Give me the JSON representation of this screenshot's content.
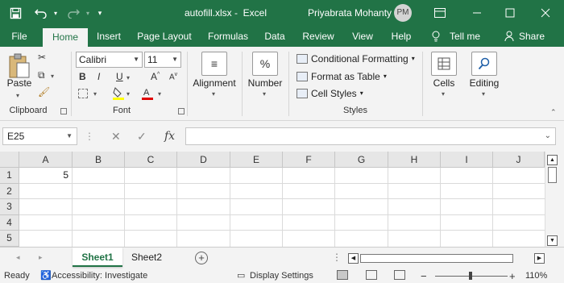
{
  "titlebar": {
    "filename": "autofill.xlsx",
    "app_name": "Excel",
    "title_sep": " -  ",
    "user_name": "Priyabrata Mohanty",
    "user_initials": "PM",
    "accent_color": "#217346",
    "icons": {
      "save": "save-icon",
      "undo": "undo-icon",
      "redo": "redo-icon",
      "customize": "customize-qat-icon",
      "ribbon_display": "ribbon-display-icon",
      "minimize": "minimize-icon",
      "maximize": "maximize-icon",
      "close": "close-icon"
    }
  },
  "tabs": [
    {
      "label": "File"
    },
    {
      "label": "Home",
      "active": true
    },
    {
      "label": "Insert"
    },
    {
      "label": "Page Layout"
    },
    {
      "label": "Formulas"
    },
    {
      "label": "Data"
    },
    {
      "label": "Review"
    },
    {
      "label": "View"
    },
    {
      "label": "Help"
    },
    {
      "label": "Tell me"
    },
    {
      "label": "Share"
    }
  ],
  "ribbon": {
    "clipboard": {
      "label": "Clipboard",
      "paste": "Paste"
    },
    "font": {
      "label": "Font",
      "name": "Calibri",
      "size": "11",
      "bold": "B",
      "italic": "I",
      "underline": "U",
      "grow": "A",
      "shrink": "A"
    },
    "alignment": {
      "label": "Alignment",
      "icon_glyph": "≡"
    },
    "number": {
      "label": "Number",
      "icon_glyph": "%"
    },
    "styles": {
      "label": "Styles",
      "conditional": "Conditional Formatting",
      "format_table": "Format as Table",
      "cell_styles": "Cell Styles"
    },
    "cells": {
      "label": "Cells"
    },
    "editing": {
      "label": "Editing"
    }
  },
  "formula_bar": {
    "name_box": "E25",
    "cancel_glyph": "✕",
    "enter_glyph": "✓",
    "fx_glyph": "fx",
    "formula": ""
  },
  "grid": {
    "columns": [
      "A",
      "B",
      "C",
      "D",
      "E",
      "F",
      "G",
      "H",
      "I",
      "J"
    ],
    "rows": [
      "1",
      "2",
      "3",
      "4",
      "5"
    ],
    "cells": {
      "A1": "5"
    }
  },
  "sheets": {
    "tabs": [
      {
        "label": "Sheet1",
        "active": true
      },
      {
        "label": "Sheet2"
      }
    ],
    "add_glyph": "+"
  },
  "statusbar": {
    "ready": "Ready",
    "accessibility": "Accessibility: Investigate",
    "display_settings": "Display Settings",
    "zoom_minus": "−",
    "zoom_plus": "+",
    "zoom": "110%"
  }
}
